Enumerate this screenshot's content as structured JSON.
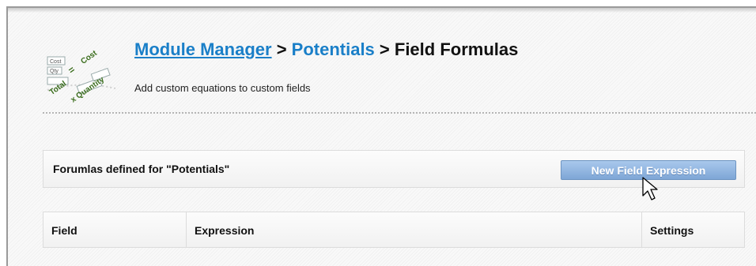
{
  "header": {
    "breadcrumb": [
      {
        "label": "Module Manager",
        "link": true
      },
      {
        "label": "Potentials",
        "link": true
      },
      {
        "label": "Field Formulas",
        "link": false
      }
    ],
    "separator": " > ",
    "subtitle": "Add custom equations to custom fields",
    "icon": {
      "name": "field-formula-icon",
      "labels": [
        "Cost",
        "Qty",
        "Total",
        "=",
        "Cost",
        "x Quantity"
      ]
    }
  },
  "section": {
    "label": "Forumlas defined for \"Potentials\"",
    "new_button_label": "New Field Expression"
  },
  "table": {
    "columns": [
      "Field",
      "Expression",
      "Settings"
    ]
  },
  "colors": {
    "link": "#1a7fc8",
    "button_bg": "#8db3e0",
    "button_text": "#ffffff"
  }
}
